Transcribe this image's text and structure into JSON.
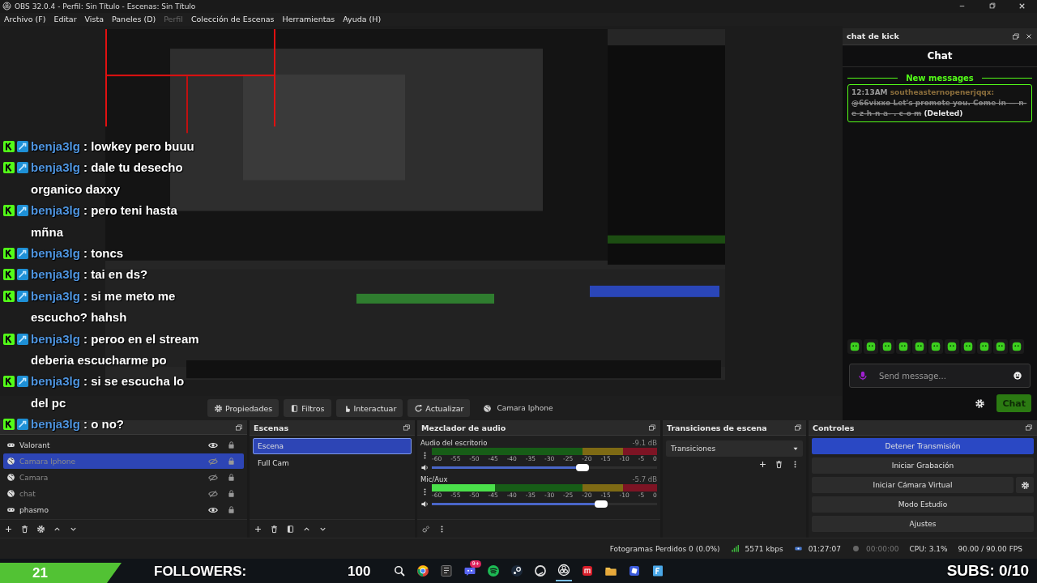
{
  "window": {
    "title": "OBS 32.0.4 - Perfil: Sin Título - Escenas: Sin Título"
  },
  "menu": [
    {
      "label": "Archivo (F)",
      "disabled": false
    },
    {
      "label": "Editar",
      "disabled": false
    },
    {
      "label": "Vista",
      "disabled": false
    },
    {
      "label": "Paneles (D)",
      "disabled": false
    },
    {
      "label": "Perfil",
      "disabled": true
    },
    {
      "label": "Colección de Escenas",
      "disabled": false
    },
    {
      "label": "Herramientas",
      "disabled": false
    },
    {
      "label": "Ayuda (H)",
      "disabled": false
    }
  ],
  "source_toolbar": {
    "source": "Camara Iphone",
    "buttons": [
      {
        "label": "Propiedades"
      },
      {
        "label": "Filtros"
      },
      {
        "label": "Interactuar"
      },
      {
        "label": "Actualizar"
      }
    ]
  },
  "chat_dock": {
    "title": "chat de kick",
    "heading": "Chat",
    "divider": "New messages",
    "messages": [
      {
        "time": "12:13AM",
        "user": "southeasternopenerjqqx:",
        "text": "@66vixxo Let's promote you. Come in — n-e-z-h-n-a- . c-o m",
        "deleted": true,
        "deleted_label": "(Deleted)"
      }
    ],
    "input": {
      "placeholder": "Send message..."
    },
    "send_button": "Chat"
  },
  "docks": {
    "sources": {
      "items": [
        {
          "name": "Valorant",
          "kind": "game",
          "visible": true,
          "selected": false
        },
        {
          "name": "Camara Iphone",
          "kind": "browser",
          "visible": false,
          "selected": true
        },
        {
          "name": "Camara",
          "kind": "browser",
          "visible": false,
          "selected": false
        },
        {
          "name": "chat",
          "kind": "browser",
          "visible": false,
          "selected": false
        },
        {
          "name": "phasmo",
          "kind": "game",
          "visible": true,
          "selected": false
        }
      ]
    },
    "scenes": {
      "title": "Escenas",
      "items": [
        {
          "name": "Escena",
          "selected": true
        },
        {
          "name": "Full Cam",
          "selected": false
        }
      ]
    },
    "mixer": {
      "title": "Mezclador de audio",
      "channels": [
        {
          "name": "Audio del escritorio",
          "reading": "-9.1 dB",
          "meter": {
            "level": 0
          },
          "volume": {
            "level": 0.67
          },
          "scale": [
            "-60",
            "-55",
            "-50",
            "-45",
            "-40",
            "-35",
            "-30",
            "-25",
            "-20",
            "-15",
            "-10",
            "-5",
            "0"
          ]
        },
        {
          "name": "Mic/Aux",
          "reading": "-5.7 dB",
          "meter": {
            "level": 0.28
          },
          "volume": {
            "level": 0.75
          },
          "scale": [
            "-60",
            "-55",
            "-50",
            "-45",
            "-40",
            "-35",
            "-30",
            "-25",
            "-20",
            "-15",
            "-10",
            "-5",
            "0"
          ]
        }
      ]
    },
    "transitions": {
      "title": "Transiciones de escena",
      "value": "Transiciones"
    },
    "controls": {
      "title": "Controles",
      "buttons": [
        {
          "label": "Detener Transmisión",
          "active": true,
          "settings": false
        },
        {
          "label": "Iniciar Grabación",
          "active": false,
          "settings": false
        },
        {
          "label": "Iniciar Cámara Virtual",
          "active": false,
          "settings": true
        },
        {
          "label": "Modo Estudio",
          "active": false,
          "settings": false
        },
        {
          "label": "Ajustes",
          "active": false,
          "settings": false
        }
      ]
    }
  },
  "status_bar": {
    "dropped_frames": "Fotogramas Perdidos 0 (0.0%)",
    "bitrate": "5571 kbps",
    "stream_time": "01:27:07",
    "record_time": "00:00:00",
    "cpu": "CPU: 3.1%",
    "fps": "90.00 / 90.00 FPS"
  },
  "stream_overlay": {
    "chat": [
      {
        "user": "benja3lg",
        "text": ": lowkey pero buuu"
      },
      {
        "user": "benja3lg",
        "text": ": dale tu desecho organico daxxy"
      },
      {
        "user": "benja3lg",
        "text": ": pero teni hasta mñna"
      },
      {
        "user": "benja3lg",
        "text": ": toncs"
      },
      {
        "user": "benja3lg",
        "text": ": tai en ds?"
      },
      {
        "user": "benja3lg",
        "text": ": si me meto me escucho? hahsh"
      },
      {
        "user": "benja3lg",
        "text": ": peroo en el stream deberia escucharme po"
      },
      {
        "user": "benja3lg",
        "text": ": si se escucha lo del pc"
      },
      {
        "user": "benja3lg",
        "text": ": o no?"
      }
    ],
    "followers_count": "21",
    "followers_label": "FOLLOWERS:",
    "followers_goal": "100",
    "subs": "SUBS: 0/10"
  },
  "taskbar": {
    "notification_badge": "9+"
  }
}
